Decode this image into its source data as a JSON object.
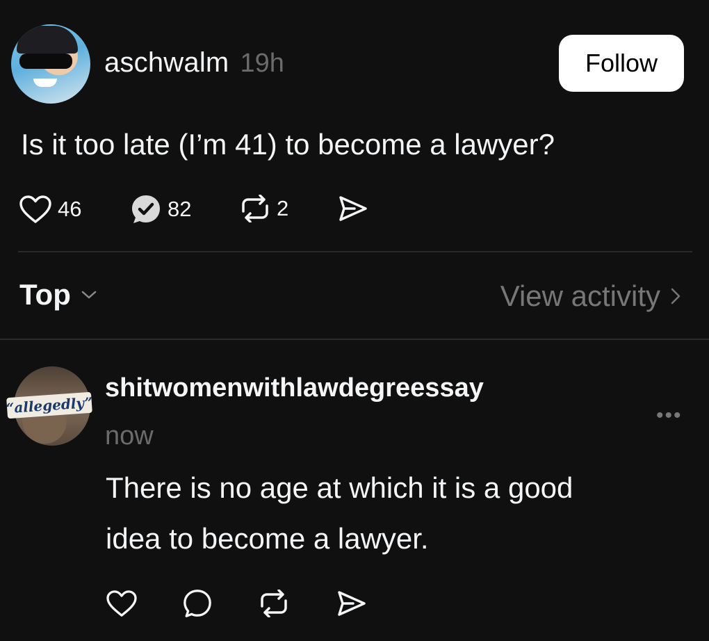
{
  "post": {
    "username": "aschwalm",
    "time": "19h",
    "follow_label": "Follow",
    "text": "Is it too late (I’m 41) to become a lawyer?",
    "likes": "46",
    "replies": "82",
    "reposts": "2"
  },
  "sort": {
    "label": "Top",
    "view_activity": "View activity"
  },
  "reply": {
    "username": "shitwomenwithlawdegreessay",
    "time": "now",
    "avatar_text": "“allegedly”",
    "text_line1": "There is no age at which it is a good",
    "text_line2": "idea to become a lawyer.",
    "more": "•••"
  },
  "icons": {
    "like": "heart-icon",
    "reply": "comment-icon",
    "repost": "repost-icon",
    "share": "send-icon",
    "chevron_down": "chevron-down-icon",
    "chevron_right": "chevron-right-icon"
  }
}
